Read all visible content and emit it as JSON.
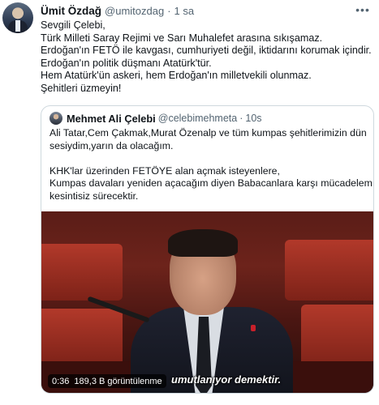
{
  "tweet": {
    "author_name": "Ümit Özdağ",
    "author_handle": "@umitozdag",
    "separator": "·",
    "time": "1 sa",
    "more_icon": "more-horizontal-icon",
    "lines": [
      "Sevgili Çelebi,",
      "Türk Milleti Saray Rejimi ve Sarı Muhalefet arasına sıkışamaz.",
      "Erdoğan'ın FETÖ ile kavgası, cumhuriyeti değil, iktidarını korumak içindir.",
      "Erdoğan'ın politik düşmanı Atatürk'tür.",
      "Hem Atatürk'ün askeri, hem Erdoğan'ın milletvekili olunmaz.",
      "Şehitleri üzmeyin!"
    ]
  },
  "quote": {
    "author_name": "Mehmet Ali Çelebi",
    "author_handle": "@celebimehmeta",
    "separator": "·",
    "time": "10s",
    "lines": [
      "Ali Tatar,Cem Çakmak,Murat Özenalp ve tüm kumpas şehitlerimizin dün",
      "sesiydim,yarın da olacağım.",
      "",
      "KHK'lar üzerinden FETÖYE alan açmak isteyenlere,",
      "Kumpas davaları yeniden açacağım diyen Babacanlara karşı mücadelem",
      "kesintisiz sürecektir."
    ],
    "video": {
      "duration": "0:36",
      "views": "189,3 B görüntülenme",
      "subtitle": "umutlanıyor demektir."
    }
  }
}
